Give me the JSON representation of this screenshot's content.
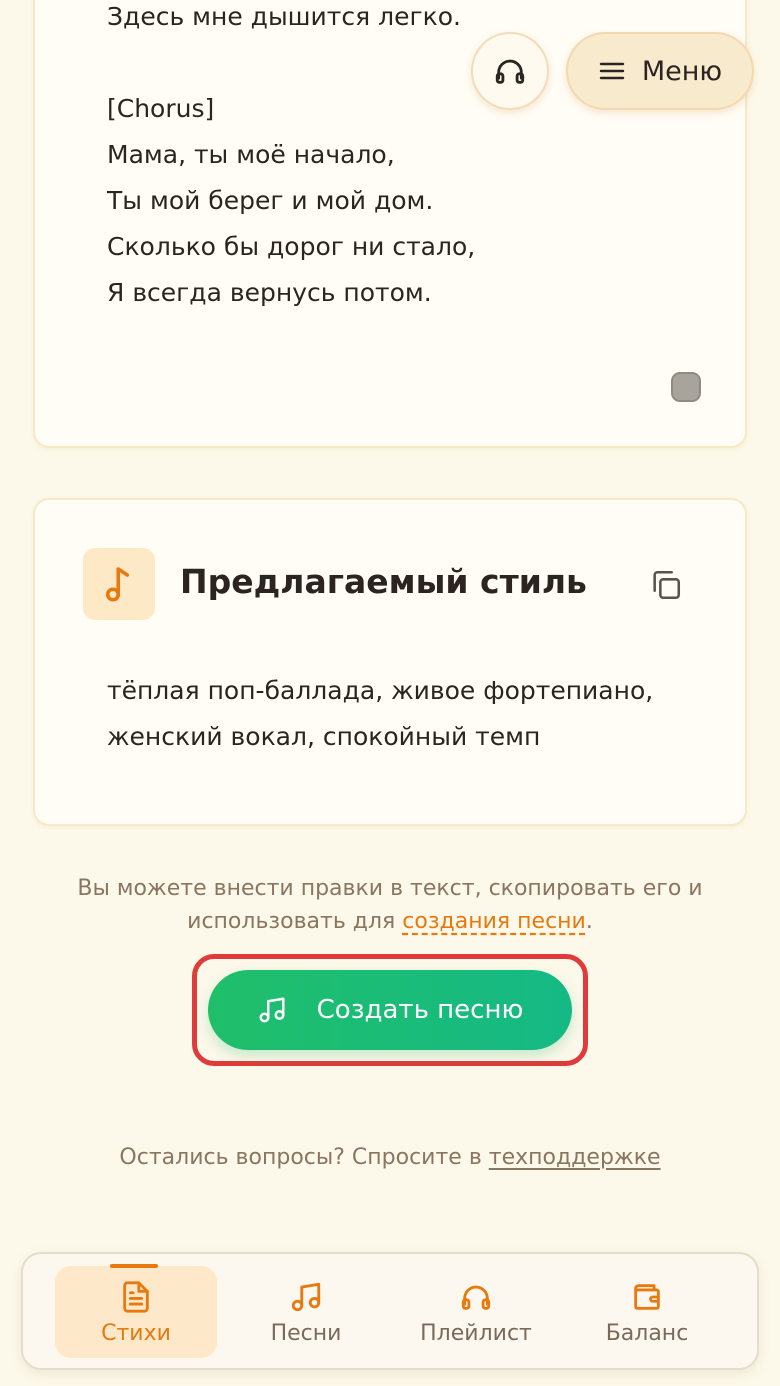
{
  "lyrics": {
    "lines": [
      "Здесь мне дышится легко.",
      "",
      "[Chorus]",
      "Мама, ты моё начало,",
      "Ты мой берег и мой дом.",
      "Сколько бы дорог ни стало,",
      "Я всегда вернусь потом."
    ]
  },
  "header": {
    "headphones_icon": "headphones-icon",
    "menu_label": "Меню",
    "menu_icon": "hamburger-icon"
  },
  "style_card": {
    "icon": "music-note-icon",
    "title": "Предлагаемый стиль",
    "copy_icon": "copy-icon",
    "text": "тёплая поп-баллада, живое фортепиано, женский вокал, спокойный темп"
  },
  "hint": {
    "text_before": "Вы можете внести правки в текст, скопировать его и использовать для ",
    "link": "создания песни",
    "text_after": "."
  },
  "create_button": {
    "label": "Создать песню",
    "icon": "music-notes-icon"
  },
  "support": {
    "text": "Остались вопросы? Спросите в ",
    "link": "техподдержке"
  },
  "bottom_nav": {
    "items": [
      {
        "label": "Стихи",
        "icon": "document-icon",
        "active": true
      },
      {
        "label": "Песни",
        "icon": "music-notes-icon",
        "active": false
      },
      {
        "label": "Плейлист",
        "icon": "headphones-icon",
        "active": false
      },
      {
        "label": "Баланс",
        "icon": "wallet-icon",
        "active": false
      }
    ]
  },
  "colors": {
    "background": "#fdf9ea",
    "accent": "#e8790e",
    "primary_button": "#1fbf6a",
    "highlight": "#e03a3a"
  }
}
